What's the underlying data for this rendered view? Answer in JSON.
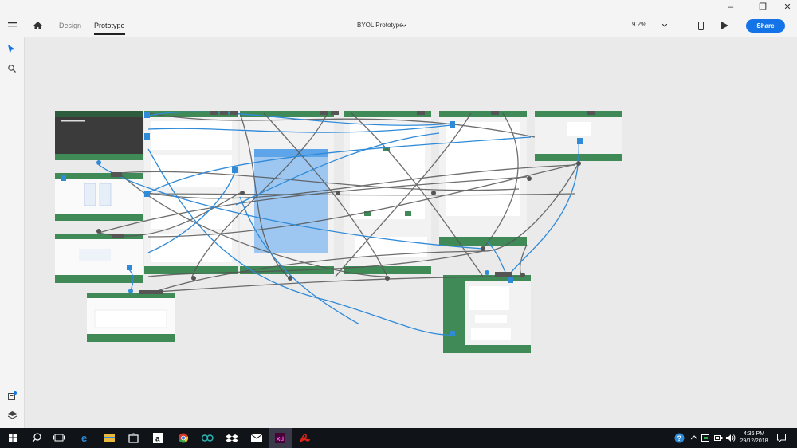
{
  "window": {
    "minimize": "–",
    "restore": "❐",
    "close": "✕"
  },
  "appbar": {
    "tabs": [
      {
        "label": "Design"
      },
      {
        "label": "Prototype"
      }
    ],
    "active_tab": "Prototype",
    "document_title": "BYOL Prototype",
    "zoom": "9.2%",
    "share_label": "Share"
  },
  "taskbar": {
    "time": "4:36 PM",
    "date": "29/12/2018"
  },
  "colors": {
    "accent": "#1473e6",
    "brand_green": "#3f8a57",
    "wire_blue": "#2f8ad8",
    "wire_grey": "#555555"
  }
}
